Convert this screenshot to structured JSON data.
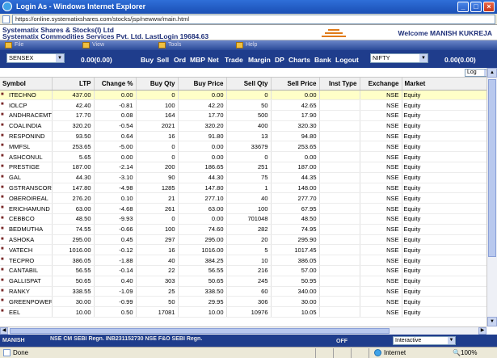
{
  "window": {
    "title": "Login As - Windows Internet Explorer",
    "url": "https://online.systematixshares.com/stocks/jsp/newww/main.html"
  },
  "brand": {
    "line1": "Systematix Shares & Stocks(I) Ltd",
    "line2": "Systematix Commodities Services Pvt. Ltd. LastLogin 19684.63",
    "welcome": "Welcome MANISH KUKREJA"
  },
  "menu": [
    "File",
    "View",
    "Tools",
    "Help"
  ],
  "index_left": {
    "selected": "SENSEX",
    "value": "0.00(0.00)"
  },
  "index_right": {
    "selected": "NIFTY",
    "value": "0.00(0.00)"
  },
  "commands": [
    "Buy",
    "Sell",
    "Ord",
    "MBP",
    "Net",
    "Trade",
    "Margin",
    "DP",
    "Charts",
    "Bank",
    "Logout"
  ],
  "log_select": "Log",
  "table": {
    "headers": [
      "Symbol",
      "LTP",
      "Change %",
      "Buy Qty",
      "Buy Price",
      "Sell Qty",
      "Sell Price",
      "Inst Type",
      "Exchange",
      "Market"
    ],
    "rows": [
      [
        "ITECHNO",
        "437.00",
        "0.00",
        "0",
        "0.00",
        "0",
        "0.00",
        "",
        "NSE",
        "Equity"
      ],
      [
        "IOLCP",
        "42.40",
        "-0.81",
        "100",
        "42.20",
        "50",
        "42.65",
        "",
        "NSE",
        "Equity"
      ],
      [
        "ANDHRACEMT",
        "17.70",
        "0.08",
        "164",
        "17.70",
        "500",
        "17.90",
        "",
        "NSE",
        "Equity"
      ],
      [
        "COALINDIA",
        "320.20",
        "-0.54",
        "2021",
        "320.20",
        "400",
        "320.30",
        "",
        "NSE",
        "Equity"
      ],
      [
        "RESPONIND",
        "93.50",
        "0.64",
        "16",
        "91.80",
        "13",
        "94.80",
        "",
        "NSE",
        "Equity"
      ],
      [
        "MMFSL",
        "253.65",
        "-5.00",
        "0",
        "0.00",
        "33679",
        "253.65",
        "",
        "NSE",
        "Equity"
      ],
      [
        "ASHCONUL",
        "5.65",
        "0.00",
        "0",
        "0.00",
        "0",
        "0.00",
        "",
        "NSE",
        "Equity"
      ],
      [
        "PRESTIGE",
        "187.00",
        "-2.14",
        "200",
        "186.65",
        "251",
        "187.00",
        "",
        "NSE",
        "Equity"
      ],
      [
        "GAL",
        "44.30",
        "-3.10",
        "90",
        "44.30",
        "75",
        "44.35",
        "",
        "NSE",
        "Equity"
      ],
      [
        "GSTRANSCOR",
        "147.80",
        "-4.98",
        "1285",
        "147.80",
        "1",
        "148.00",
        "",
        "NSE",
        "Equity"
      ],
      [
        "OBEROIREAL",
        "276.20",
        "0.10",
        "21",
        "277.10",
        "40",
        "277.70",
        "",
        "NSE",
        "Equity"
      ],
      [
        "ERICHAMUND",
        "63.00",
        "-4.68",
        "261",
        "63.00",
        "100",
        "67.95",
        "",
        "NSE",
        "Equity"
      ],
      [
        "CEBBCO",
        "48.50",
        "-9.93",
        "0",
        "0.00",
        "701048",
        "48.50",
        "",
        "NSE",
        "Equity"
      ],
      [
        "BEDMUTHA",
        "74.55",
        "-0.66",
        "100",
        "74.60",
        "282",
        "74.95",
        "",
        "NSE",
        "Equity"
      ],
      [
        "ASHOKA",
        "295.00",
        "0.45",
        "297",
        "295.00",
        "20",
        "295.90",
        "",
        "NSE",
        "Equity"
      ],
      [
        "VATECH",
        "1016.00",
        "-0.12",
        "16",
        "1016.00",
        "5",
        "1017.45",
        "",
        "NSE",
        "Equity"
      ],
      [
        "TECPRO",
        "386.05",
        "-1.88",
        "40",
        "384.25",
        "10",
        "386.05",
        "",
        "NSE",
        "Equity"
      ],
      [
        "CANTABIL",
        "56.55",
        "-0.14",
        "22",
        "56.55",
        "216",
        "57.00",
        "",
        "NSE",
        "Equity"
      ],
      [
        "GALLISPAT",
        "50.65",
        "0.40",
        "303",
        "50.65",
        "245",
        "50.95",
        "",
        "NSE",
        "Equity"
      ],
      [
        "RANKY",
        "338.55",
        "-1.09",
        "25",
        "338.50",
        "60",
        "340.00",
        "",
        "NSE",
        "Equity"
      ],
      [
        "GREENPOWER",
        "30.00",
        "-0.99",
        "50",
        "29.95",
        "306",
        "30.00",
        "",
        "NSE",
        "Equity"
      ],
      [
        "EEL",
        "10.00",
        "0.50",
        "17081",
        "10.00",
        "10976",
        "10.05",
        "",
        "NSE",
        "Equity"
      ]
    ]
  },
  "footer": {
    "left": "MANISH",
    "sebi": "NSE CM SEBI Regn. INB231152730 NSE F&O SEBI Regn.",
    "status_word": "OFF",
    "mode_select": "Interactive"
  },
  "statusbar": {
    "done": "Done",
    "zone": "Internet",
    "zoom": "100%"
  }
}
